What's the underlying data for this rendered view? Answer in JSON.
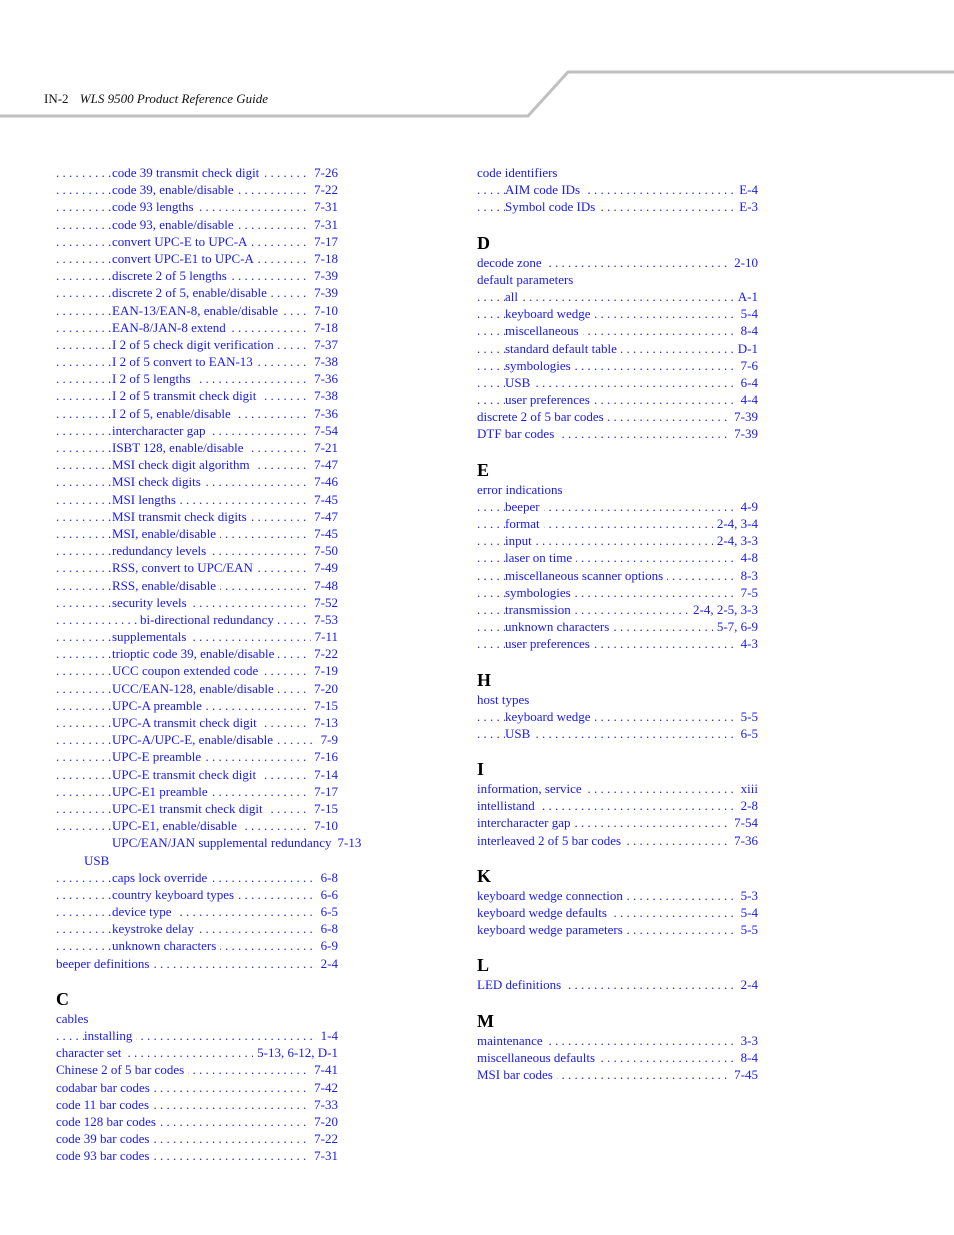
{
  "header": {
    "page_number": "IN-2",
    "title": "WLS 9500 Product Reference Guide",
    "rule_color": "#c0c0c0"
  },
  "link_color": "#1a1ae6",
  "left_column": [
    {
      "level": 3,
      "label": "code 39 transmit check digit",
      "page": "7-26"
    },
    {
      "level": 3,
      "label": "code 39, enable/disable",
      "page": "7-22"
    },
    {
      "level": 3,
      "label": "code 93 lengths",
      "page": "7-31"
    },
    {
      "level": 3,
      "label": "code 93, enable/disable",
      "page": "7-31"
    },
    {
      "level": 3,
      "label": "convert UPC-E to UPC-A",
      "page": "7-17"
    },
    {
      "level": 3,
      "label": "convert UPC-E1 to UPC-A",
      "page": "7-18"
    },
    {
      "level": 3,
      "label": "discrete 2 of 5 lengths",
      "page": "7-39"
    },
    {
      "level": 3,
      "label": "discrete 2 of 5, enable/disable",
      "page": "7-39"
    },
    {
      "level": 3,
      "label": "EAN-13/EAN-8, enable/disable",
      "page": "7-10"
    },
    {
      "level": 3,
      "label": "EAN-8/JAN-8 extend",
      "page": "7-18"
    },
    {
      "level": 3,
      "label": "I 2 of 5 check digit verification",
      "page": "7-37"
    },
    {
      "level": 3,
      "label": "I 2 of 5 convert to EAN-13",
      "page": "7-38"
    },
    {
      "level": 3,
      "label": "I 2 of 5 lengths",
      "page": "7-36"
    },
    {
      "level": 3,
      "label": "I 2 of 5 transmit check digit",
      "page": "7-38"
    },
    {
      "level": 3,
      "label": "I 2 of 5, enable/disable",
      "page": "7-36"
    },
    {
      "level": 3,
      "label": "intercharacter gap",
      "page": "7-54"
    },
    {
      "level": 3,
      "label": "ISBT 128, enable/disable",
      "page": "7-21"
    },
    {
      "level": 3,
      "label": "MSI check digit algorithm",
      "page": "7-47"
    },
    {
      "level": 3,
      "label": "MSI check digits",
      "page": "7-46"
    },
    {
      "level": 3,
      "label": "MSI lengths",
      "page": "7-45"
    },
    {
      "level": 3,
      "label": "MSI transmit check digits",
      "page": "7-47"
    },
    {
      "level": 3,
      "label": "MSI, enable/disable",
      "page": "7-45"
    },
    {
      "level": 3,
      "label": "redundancy levels",
      "page": "7-50"
    },
    {
      "level": 3,
      "label": "RSS, convert to UPC/EAN",
      "page": "7-49"
    },
    {
      "level": 3,
      "label": "RSS, enable/disable",
      "page": "7-48"
    },
    {
      "level": 3,
      "label": "security levels",
      "page": "7-52"
    },
    {
      "level": 4,
      "label": "bi-directional redundancy",
      "page": "7-53"
    },
    {
      "level": 3,
      "label": "supplementals",
      "page": "7-11"
    },
    {
      "level": 3,
      "label": "trioptic code 39, enable/disable",
      "page": "7-22"
    },
    {
      "level": 3,
      "label": "UCC coupon extended code",
      "page": "7-19"
    },
    {
      "level": 3,
      "label": "UCC/EAN-128, enable/disable",
      "page": "7-20"
    },
    {
      "level": 3,
      "label": "UPC-A preamble",
      "page": "7-15"
    },
    {
      "level": 3,
      "label": "UPC-A transmit check digit",
      "page": "7-13"
    },
    {
      "level": 3,
      "label": "UPC-A/UPC-E, enable/disable",
      "page": "7-9"
    },
    {
      "level": 3,
      "label": "UPC-E preamble",
      "page": "7-16"
    },
    {
      "level": 3,
      "label": "UPC-E transmit check digit",
      "page": "7-14"
    },
    {
      "level": 3,
      "label": "UPC-E1 preamble",
      "page": "7-17"
    },
    {
      "level": 3,
      "label": "UPC-E1 transmit check digit",
      "page": "7-15"
    },
    {
      "level": 3,
      "label": "UPC-E1, enable/disable",
      "page": "7-10"
    },
    {
      "level": 3,
      "label": "UPC/EAN/JAN supplemental redundancy",
      "page": "7-13",
      "nodots": true
    },
    {
      "level": 2,
      "label": "USB",
      "page": null
    },
    {
      "level": 3,
      "label": "caps lock override",
      "page": "6-8"
    },
    {
      "level": 3,
      "label": "country keyboard types",
      "page": "6-6"
    },
    {
      "level": 3,
      "label": "device type",
      "page": "6-5"
    },
    {
      "level": 3,
      "label": "keystroke delay",
      "page": "6-8"
    },
    {
      "level": 3,
      "label": "unknown characters",
      "page": "6-9"
    },
    {
      "level": 1,
      "label": "beeper definitions",
      "page": "2-4"
    },
    {
      "letter": "C"
    },
    {
      "level": 1,
      "label": "cables",
      "page": null
    },
    {
      "level": 2,
      "label": "installing",
      "page": "1-4"
    },
    {
      "level": 1,
      "label": "character set",
      "page": "5-13, 6-12, D-1"
    },
    {
      "level": 1,
      "label": "Chinese 2 of 5 bar codes",
      "page": "7-41"
    },
    {
      "level": 1,
      "label": "codabar bar codes",
      "page": "7-42"
    },
    {
      "level": 1,
      "label": "code 11 bar codes",
      "page": "7-33"
    },
    {
      "level": 1,
      "label": "code 128 bar codes",
      "page": "7-20"
    },
    {
      "level": 1,
      "label": "code 39 bar codes",
      "page": "7-22"
    },
    {
      "level": 1,
      "label": "code 93 bar codes",
      "page": "7-31"
    }
  ],
  "right_column": [
    {
      "level": 1,
      "label": "code identifiers",
      "page": null
    },
    {
      "level": 2,
      "label": "AIM code IDs",
      "page": "E-4"
    },
    {
      "level": 2,
      "label": "Symbol code IDs",
      "page": "E-3"
    },
    {
      "letter": "D"
    },
    {
      "level": 1,
      "label": "decode zone",
      "page": "2-10"
    },
    {
      "level": 1,
      "label": "default parameters",
      "page": null
    },
    {
      "level": 2,
      "label": "all",
      "page": "A-1"
    },
    {
      "level": 2,
      "label": "keyboard wedge",
      "page": "5-4"
    },
    {
      "level": 2,
      "label": "miscellaneous",
      "page": "8-4"
    },
    {
      "level": 2,
      "label": "standard default table",
      "page": "D-1"
    },
    {
      "level": 2,
      "label": "symbologies",
      "page": "7-6"
    },
    {
      "level": 2,
      "label": "USB",
      "page": "6-4"
    },
    {
      "level": 2,
      "label": "user preferences",
      "page": "4-4"
    },
    {
      "level": 1,
      "label": "discrete 2 of 5 bar codes",
      "page": "7-39"
    },
    {
      "level": 1,
      "label": "DTF bar codes",
      "page": "7-39"
    },
    {
      "letter": "E"
    },
    {
      "level": 1,
      "label": "error indications",
      "page": null
    },
    {
      "level": 2,
      "label": "beeper",
      "page": "4-9"
    },
    {
      "level": 2,
      "label": "format",
      "page": "2-4, 3-4"
    },
    {
      "level": 2,
      "label": "input",
      "page": "2-4, 3-3"
    },
    {
      "level": 2,
      "label": "laser on time",
      "page": "4-8"
    },
    {
      "level": 2,
      "label": "miscellaneous scanner options",
      "page": "8-3"
    },
    {
      "level": 2,
      "label": "symbologies",
      "page": "7-5"
    },
    {
      "level": 2,
      "label": "transmission",
      "page": "2-4, 2-5, 3-3"
    },
    {
      "level": 2,
      "label": "unknown characters",
      "page": "5-7, 6-9"
    },
    {
      "level": 2,
      "label": "user preferences",
      "page": "4-3"
    },
    {
      "letter": "H"
    },
    {
      "level": 1,
      "label": "host types",
      "page": null
    },
    {
      "level": 2,
      "label": "keyboard wedge",
      "page": "5-5"
    },
    {
      "level": 2,
      "label": "USB",
      "page": "6-5"
    },
    {
      "letter": "I"
    },
    {
      "level": 1,
      "label": "information, service",
      "page": "xiii"
    },
    {
      "level": 1,
      "label": "intellistand",
      "page": "2-8"
    },
    {
      "level": 1,
      "label": "intercharacter gap",
      "page": "7-54"
    },
    {
      "level": 1,
      "label": "interleaved 2 of 5 bar codes",
      "page": "7-36"
    },
    {
      "letter": "K"
    },
    {
      "level": 1,
      "label": "keyboard wedge connection",
      "page": "5-3"
    },
    {
      "level": 1,
      "label": "keyboard wedge defaults",
      "page": "5-4"
    },
    {
      "level": 1,
      "label": "keyboard wedge parameters",
      "page": "5-5"
    },
    {
      "letter": "L"
    },
    {
      "level": 1,
      "label": "LED definitions",
      "page": "2-4"
    },
    {
      "letter": "M"
    },
    {
      "level": 1,
      "label": "maintenance",
      "page": "3-3"
    },
    {
      "level": 1,
      "label": "miscellaneous defaults",
      "page": "8-4"
    },
    {
      "level": 1,
      "label": "MSI bar codes",
      "page": "7-45"
    }
  ]
}
